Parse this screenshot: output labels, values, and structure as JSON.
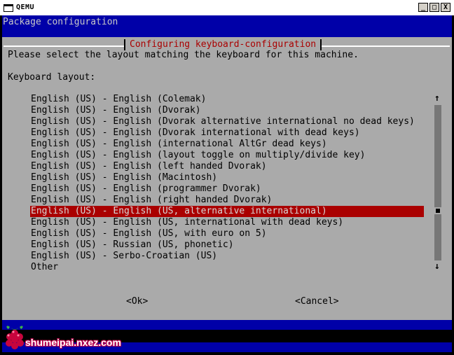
{
  "window": {
    "title": "QEMU",
    "controls": [
      "_",
      "□",
      "X"
    ]
  },
  "header": {
    "title": "Package configuration"
  },
  "dialog": {
    "title": "Configuring keyboard-configuration",
    "prompt": "Please select the layout matching the keyboard for this machine.",
    "field_label": "Keyboard layout:",
    "items": [
      "English (US) - English (Colemak)",
      "English (US) - English (Dvorak)",
      "English (US) - English (Dvorak alternative international no dead keys)",
      "English (US) - English (Dvorak international with dead keys)",
      "English (US) - English (international AltGr dead keys)",
      "English (US) - English (layout toggle on multiply/divide key)",
      "English (US) - English (left handed Dvorak)",
      "English (US) - English (Macintosh)",
      "English (US) - English (programmer Dvorak)",
      "English (US) - English (right handed Dvorak)",
      "English (US) - English (US, alternative international)",
      "English (US) - English (US, international with dead keys)",
      "English (US) - English (US, with euro on 5)",
      "English (US) - Russian (US, phonetic)",
      "English (US) - Serbo-Croatian (US)",
      "Other"
    ],
    "selected_index": 10,
    "scroll_up_glyph": "↑",
    "scroll_down_glyph": "↓",
    "ok_label": "<Ok>",
    "cancel_label": "<Cancel>"
  },
  "watermark": {
    "text": "shumeipai.nxez.com",
    "logo_icon": "raspberry-pi-logo"
  },
  "colors": {
    "header_blue": "#0000a8",
    "dialog_gray": "#aaaaaa",
    "title_red": "#aa0000",
    "selection_red": "#aa0000"
  }
}
